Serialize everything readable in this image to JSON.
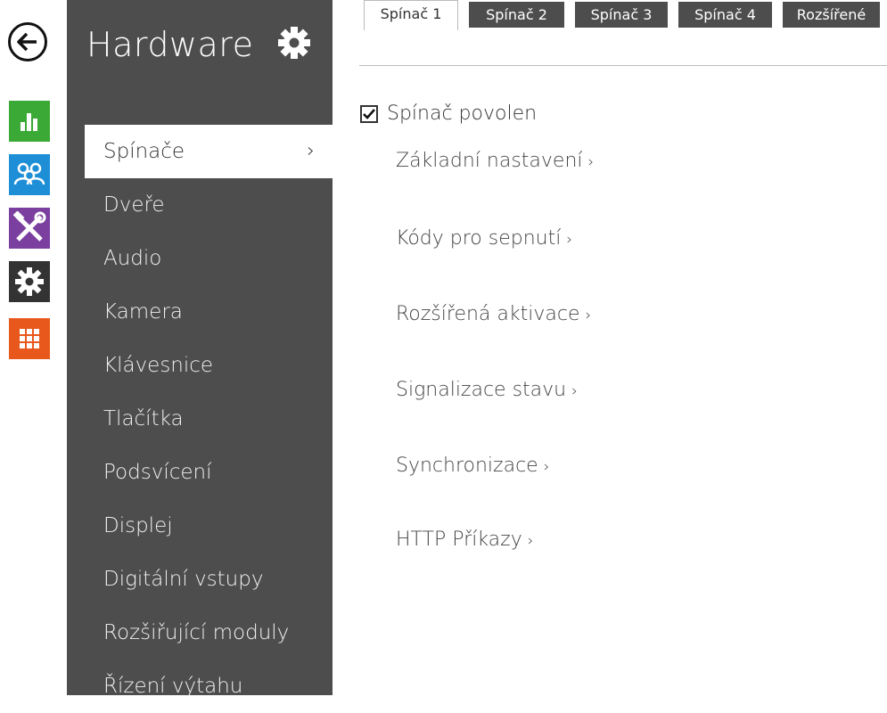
{
  "header": {
    "title": "Hardware"
  },
  "rail": {
    "icons": [
      {
        "name": "back-arrow-icon",
        "color": "#111111"
      },
      {
        "name": "status-chart-icon",
        "color": "#3aa935"
      },
      {
        "name": "users-icon",
        "color": "#1e8fd6"
      },
      {
        "name": "services-tools-icon",
        "color": "#7b3fa0"
      },
      {
        "name": "hardware-gear-icon",
        "color": "#333333"
      },
      {
        "name": "system-grid-icon",
        "color": "#e8581c"
      }
    ]
  },
  "sidebar": {
    "items": [
      {
        "label": "Spínače",
        "active": true
      },
      {
        "label": "Dveře"
      },
      {
        "label": "Audio"
      },
      {
        "label": "Kamera"
      },
      {
        "label": "Klávesnice"
      },
      {
        "label": "Tlačítka"
      },
      {
        "label": "Podsvícení"
      },
      {
        "label": "Displej"
      },
      {
        "label": "Digitální vstupy"
      },
      {
        "label": "Rozšiřující moduly"
      },
      {
        "label": "Řízení výtahu"
      }
    ],
    "active_chevron": "›"
  },
  "tabs": [
    {
      "label": "Spínač 1",
      "active": true
    },
    {
      "label": "Spínač 2"
    },
    {
      "label": "Spínač 3"
    },
    {
      "label": "Spínač 4"
    },
    {
      "label": "Rozšířené"
    }
  ],
  "content": {
    "enabled_checkbox": {
      "label": "Spínač povolen",
      "checked": true
    },
    "sections": [
      {
        "label": "Základní nastavení"
      },
      {
        "label": "Kódy pro sepnutí"
      },
      {
        "label": "Rozšířená aktivace"
      },
      {
        "label": "Signalizace stavu"
      },
      {
        "label": "Synchronizace"
      },
      {
        "label": "HTTP Příkazy"
      }
    ],
    "section_arrow": "›"
  },
  "colors": {
    "sidebar_bg": "#4d4d4d",
    "tab_inactive_bg": "#4d4d4d"
  }
}
